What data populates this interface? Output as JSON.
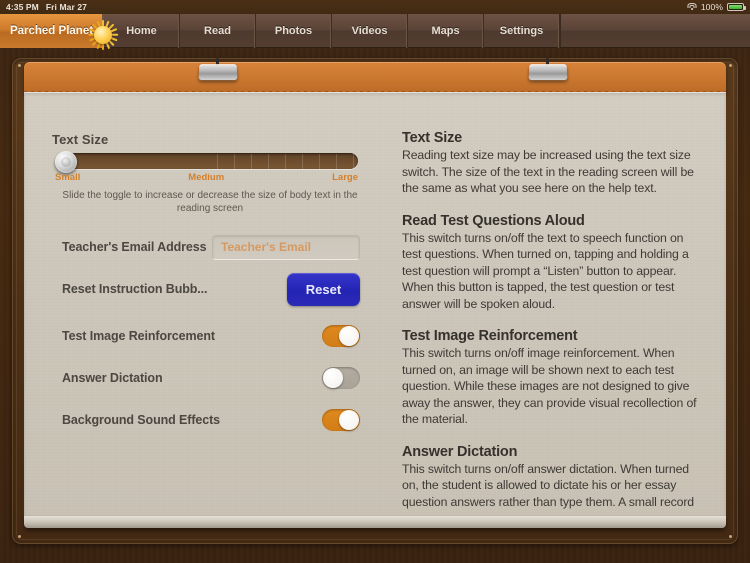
{
  "statusbar": {
    "time": "4:35 PM",
    "date": "Fri Mar 27",
    "battery_percent": "100%",
    "wifi_icon": "wifi-icon",
    "battery_icon": "battery-icon"
  },
  "nav": {
    "brand": "Parched Planet",
    "brand_icon": "sun-icon",
    "tabs": [
      {
        "label": "Home"
      },
      {
        "label": "Read"
      },
      {
        "label": "Photos"
      },
      {
        "label": "Videos"
      },
      {
        "label": "Maps"
      },
      {
        "label": "Settings"
      }
    ]
  },
  "settings": {
    "text_size": {
      "title": "Text Size",
      "small_label": "Small",
      "medium_label": "Medium",
      "large_label": "Large",
      "help": "Slide the toggle to increase or decrease the size of body text in the reading screen",
      "value": 0
    },
    "email_row": {
      "label": "Teacher's Email Address",
      "placeholder": "Teacher's Email",
      "value": ""
    },
    "reset_row": {
      "label": "Reset Instruction Bubb...",
      "button": "Reset"
    },
    "toggles": [
      {
        "label": "Test Image Reinforcement",
        "state": "on"
      },
      {
        "label": "Answer Dictation",
        "state": "off"
      },
      {
        "label": "Background Sound Effects",
        "state": "on"
      }
    ]
  },
  "help": {
    "sections": [
      {
        "heading": "Text Size",
        "body": "Reading text size may be increased using the text size switch. The size of the text in the reading screen will be the same as what you see here on the help text."
      },
      {
        "heading": "Read Test Questions Aloud",
        "body": "This switch turns on/off the text to speech function on test questions. When turned on, tapping and holding a test question will prompt a “Listen” button to appear.  When this button is tapped, the test question or test answer will be spoken aloud."
      },
      {
        "heading": "Test Image Reinforcement",
        "body": "This switch turns on/off image reinforcement. When turned on, an image will be shown next to each test question. While these images are not designed to give away the answer, they can provide visual recollection of the material."
      },
      {
        "heading": "Answer Dictation",
        "body": "This switch turns on/off answer dictation. When turned on, the student is allowed to dictate his or her essay question answers rather than type them. A small record button will"
      }
    ]
  },
  "colors": {
    "accent_orange": "#d4802b",
    "toggle_on": "#d98320",
    "reset_blue": "#2a2ab6",
    "paper": "#cdc7bb",
    "wood": "#3d2512"
  }
}
